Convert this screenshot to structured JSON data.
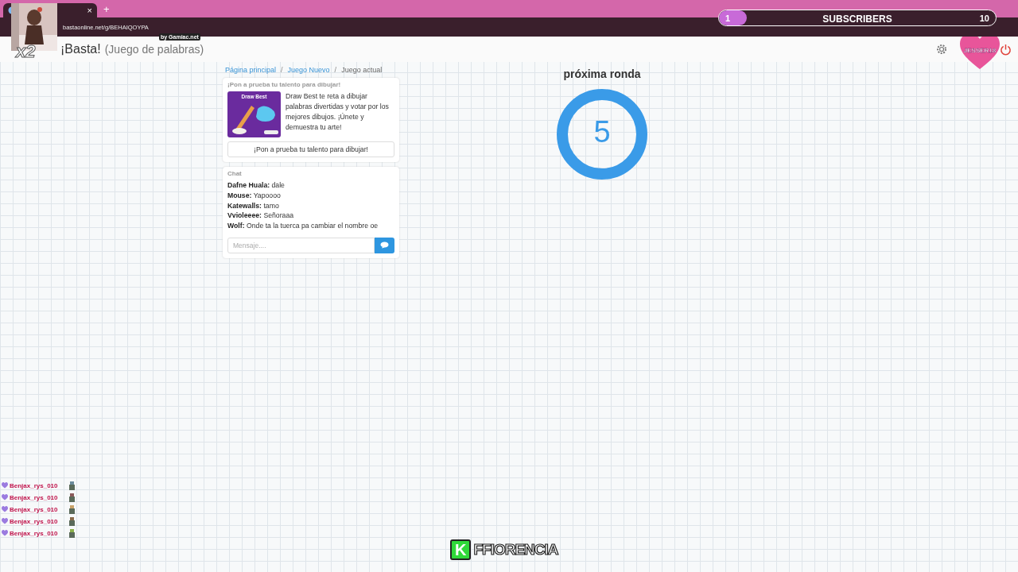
{
  "browser": {
    "address": "bastaonline.net/g/BEHAIQOYPA",
    "close": "×",
    "new_tab": "+",
    "tooltip": "by Gamiac.net"
  },
  "overlay": {
    "subscribers": {
      "current": "1",
      "label": "SUBSCRIBERS",
      "goal": "10",
      "level": 0.1
    },
    "webcam_badge": "x2",
    "top_user": "JESSER18",
    "donors": [
      {
        "name": "Benjax_rys_010"
      },
      {
        "name": "Benjax_rys_010"
      },
      {
        "name": "Benjax_rys_010"
      },
      {
        "name": "Benjax_rys_010"
      },
      {
        "name": "Benjax_rys_010"
      }
    ],
    "logo": {
      "letter": "K",
      "name": "FFIORENCIA"
    }
  },
  "header": {
    "title": "¡Basta!",
    "subtitle": "(Juego de palabras)"
  },
  "breadcrumb": {
    "separator": "/",
    "items": [
      {
        "label": "Página principal",
        "kind": "link"
      },
      {
        "label": "Juego Nuevo",
        "kind": "link"
      },
      {
        "label": "Juego actual",
        "kind": "current"
      }
    ]
  },
  "promo": {
    "heading": "¡Pon a prueba tu talento para dibujar!",
    "image_title": "Draw Best",
    "text": "Draw Best te reta a dibujar palabras divertidas y votar por los mejores dibujos. ¡Únete y demuestra tu arte!",
    "button": "¡Pon a prueba tu talento para dibujar!"
  },
  "chat": {
    "heading": "Chat",
    "messages": [
      "**Dafne Huala:** dale",
      "**Mouse:** Yapoooo",
      "**Katewalls:** tamo",
      "**Vvioleeee:** Señoraaa",
      "**Wolf:** Onde ta la tuerca pa cambiar el nombre oe"
    ],
    "input": {
      "placeholder": "Mensaje...."
    }
  },
  "countdown": {
    "label": "próxima ronda",
    "value": "5"
  }
}
